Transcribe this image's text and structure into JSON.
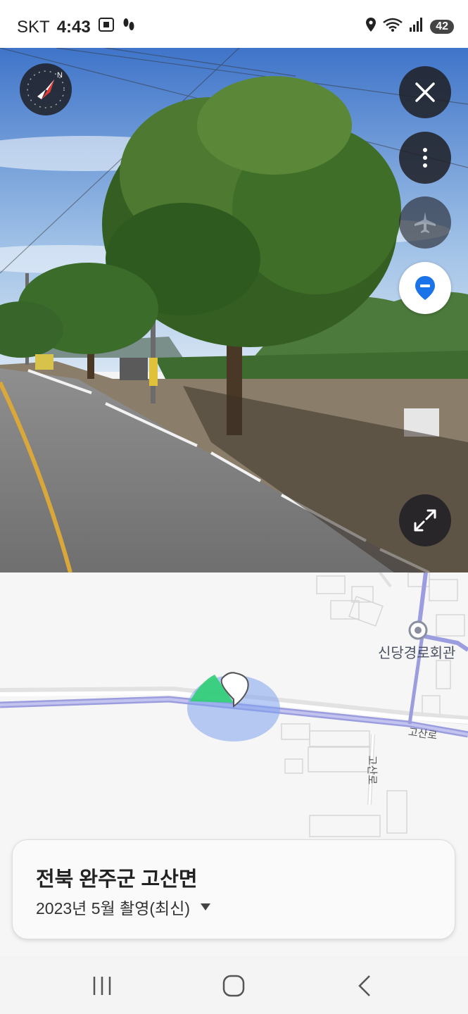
{
  "status_bar": {
    "carrier": "SKT",
    "time": "4:43",
    "battery": "42"
  },
  "street_view": {
    "compass_label": "N"
  },
  "map": {
    "poi_label": "신당경로회관",
    "road_label_main": "고산로",
    "road_label_side": "고산로"
  },
  "info_card": {
    "location_title": "전북 완주군 고산면",
    "capture_date": "2023년 5월 촬영(최신)"
  },
  "colors": {
    "road_primary": "#9b9ddf",
    "location_accent": "#1a73e8",
    "view_cone": "#3ccf7c"
  }
}
